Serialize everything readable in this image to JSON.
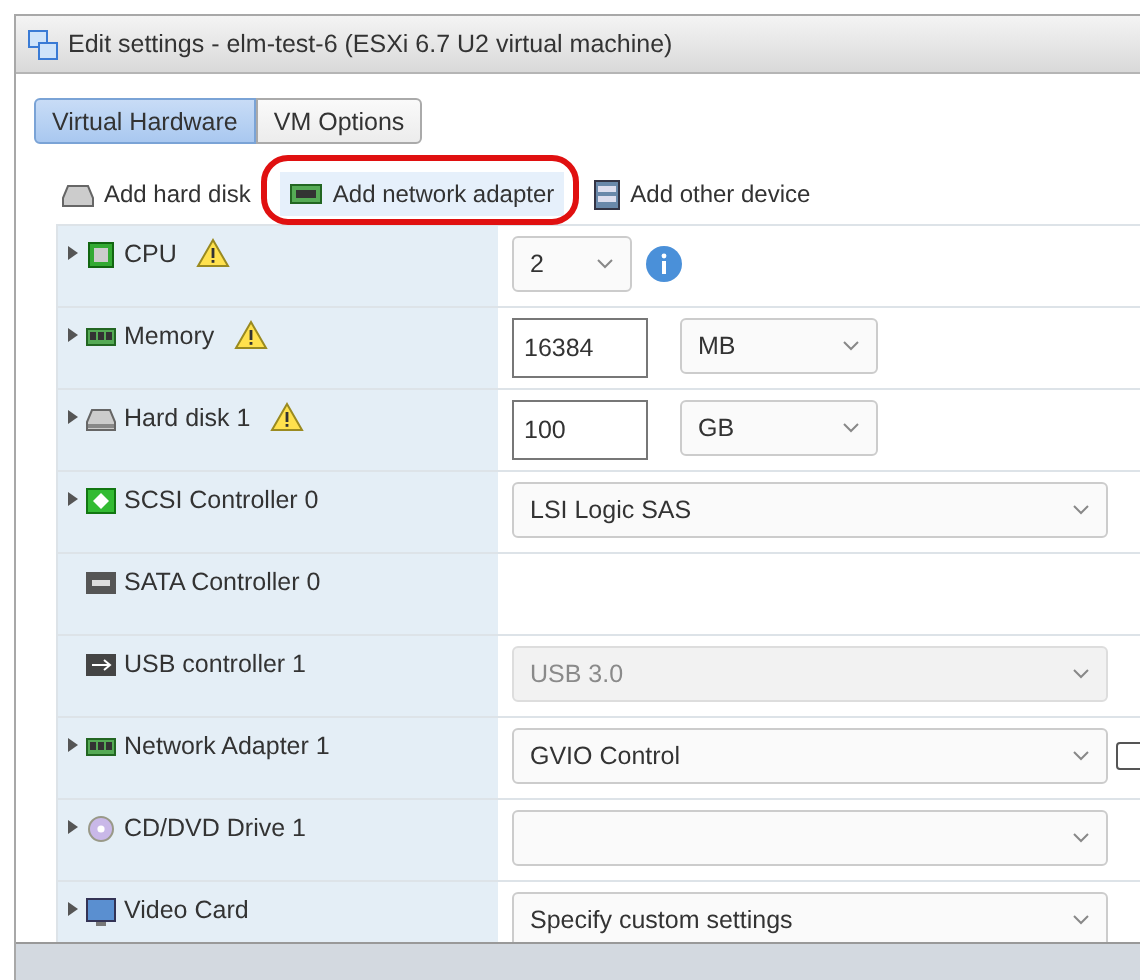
{
  "window": {
    "title": "Edit settings - elm-test-6 (ESXi 6.7 U2 virtual machine)"
  },
  "tabs": [
    {
      "label": "Virtual Hardware",
      "selected": true
    },
    {
      "label": "VM Options",
      "selected": false
    }
  ],
  "toolbar": [
    {
      "kind": "disk",
      "label": "Add hard disk",
      "selected": false
    },
    {
      "kind": "network",
      "label": "Add network adapter",
      "selected": true
    },
    {
      "kind": "device",
      "label": "Add other device",
      "selected": false
    }
  ],
  "rows": [
    {
      "kind": "cpu",
      "label": "CPU",
      "expandable": true,
      "warning": true,
      "controls": [
        {
          "kind": "small-select",
          "value": "2",
          "disabled": false
        },
        {
          "kind": "info"
        }
      ]
    },
    {
      "kind": "memory",
      "label": "Memory",
      "expandable": true,
      "warning": true,
      "controls": [
        {
          "kind": "input",
          "value": "16384"
        },
        {
          "kind": "unit-select",
          "value": "MB",
          "disabled": false
        }
      ]
    },
    {
      "kind": "disk",
      "label": "Hard disk 1",
      "expandable": true,
      "warning": true,
      "controls": [
        {
          "kind": "input",
          "value": "100"
        },
        {
          "kind": "unit-select",
          "value": "GB",
          "disabled": false
        }
      ]
    },
    {
      "kind": "scsi",
      "label": "SCSI Controller 0",
      "expandable": true,
      "warning": false,
      "controls": [
        {
          "kind": "wide-select",
          "value": "LSI Logic SAS",
          "disabled": false
        }
      ]
    },
    {
      "kind": "sata",
      "label": "SATA Controller 0",
      "expandable": false,
      "warning": false,
      "controls": []
    },
    {
      "kind": "usb",
      "label": "USB controller 1",
      "expandable": false,
      "warning": false,
      "controls": [
        {
          "kind": "wide-select",
          "value": "USB 3.0",
          "disabled": true
        }
      ]
    },
    {
      "kind": "network",
      "label": "Network Adapter 1",
      "expandable": true,
      "warning": false,
      "controls": [
        {
          "kind": "wide-select",
          "value": "GVIO Control",
          "disabled": false
        },
        {
          "kind": "checkbox",
          "checked": false
        }
      ]
    },
    {
      "kind": "cdrom",
      "label": "CD/DVD Drive 1",
      "expandable": true,
      "warning": false,
      "controls": [
        {
          "kind": "wide-select",
          "disabled": false
        }
      ]
    },
    {
      "kind": "video",
      "label": "Video Card",
      "expandable": true,
      "warning": false,
      "controls": [
        {
          "kind": "wide-select",
          "value": "Specify custom settings",
          "disabled": false
        }
      ]
    }
  ]
}
